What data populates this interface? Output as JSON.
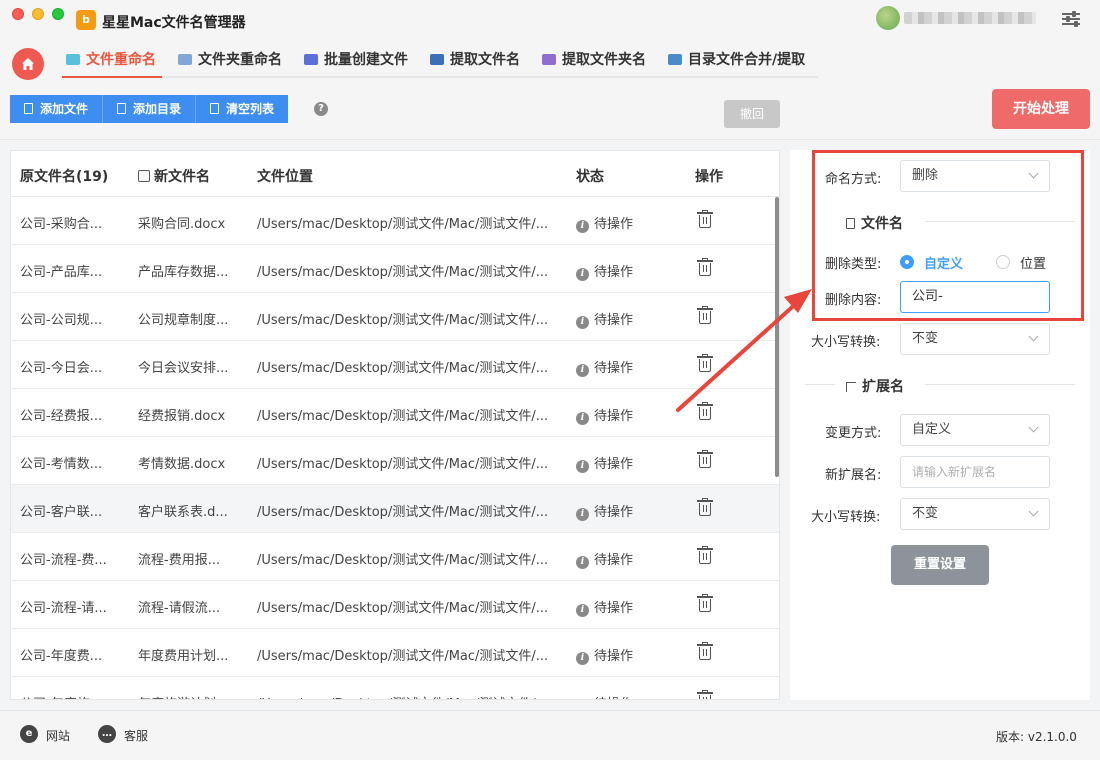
{
  "app": {
    "title": "星星Mac文件名管理器",
    "logo_text": "b"
  },
  "tabs": [
    {
      "label": "文件重命名",
      "active": true,
      "icon": "file-rename-icon"
    },
    {
      "label": "文件夹重命名",
      "active": false,
      "icon": "folder-rename-icon"
    },
    {
      "label": "批量创建文件",
      "active": false,
      "icon": "batch-create-icon"
    },
    {
      "label": "提取文件名",
      "active": false,
      "icon": "extract-filename-icon"
    },
    {
      "label": "提取文件夹名",
      "active": false,
      "icon": "extract-foldername-icon"
    },
    {
      "label": "目录文件合并/提取",
      "active": false,
      "icon": "merge-extract-icon"
    }
  ],
  "toolbar": {
    "add_file": "添加文件",
    "add_dir": "添加目录",
    "clear_list": "清空列表",
    "help": "?",
    "undo": "撤回",
    "start": "开始处理"
  },
  "table": {
    "headers": {
      "original": "原文件名(19)",
      "new": "新文件名",
      "location": "文件位置",
      "status": "状态",
      "action": "操作"
    },
    "rows": [
      {
        "original": "公司-采购合...",
        "new": "采购合同.docx",
        "location": "/Users/mac/Desktop/测试文件/Mac/测试文件/...",
        "status": "待操作"
      },
      {
        "original": "公司-产品库...",
        "new": "产品库存数据...",
        "location": "/Users/mac/Desktop/测试文件/Mac/测试文件/...",
        "status": "待操作"
      },
      {
        "original": "公司-公司规...",
        "new": "公司规章制度...",
        "location": "/Users/mac/Desktop/测试文件/Mac/测试文件/...",
        "status": "待操作"
      },
      {
        "original": "公司-今日会...",
        "new": "今日会议安排...",
        "location": "/Users/mac/Desktop/测试文件/Mac/测试文件/...",
        "status": "待操作"
      },
      {
        "original": "公司-经费报...",
        "new": "经费报销.docx",
        "location": "/Users/mac/Desktop/测试文件/Mac/测试文件/...",
        "status": "待操作"
      },
      {
        "original": "公司-考情数...",
        "new": "考情数据.docx",
        "location": "/Users/mac/Desktop/测试文件/Mac/测试文件/...",
        "status": "待操作"
      },
      {
        "original": "公司-客户联...",
        "new": "客户联系表.d...",
        "location": "/Users/mac/Desktop/测试文件/Mac/测试文件/...",
        "status": "待操作"
      },
      {
        "original": "公司-流程-费...",
        "new": "流程-费用报...",
        "location": "/Users/mac/Desktop/测试文件/Mac/测试文件/...",
        "status": "待操作"
      },
      {
        "original": "公司-流程-请...",
        "new": "流程-请假流...",
        "location": "/Users/mac/Desktop/测试文件/Mac/测试文件/...",
        "status": "待操作"
      },
      {
        "original": "公司-年度费...",
        "new": "年度费用计划...",
        "location": "/Users/mac/Desktop/测试文件/Mac/测试文件/...",
        "status": "待操作"
      },
      {
        "original": "公司-年度旅...",
        "new": "年度旅游计划...",
        "location": "/Users/mac/Desktop/测试文件/Mac/测试文件/...",
        "status": "待操作"
      }
    ]
  },
  "settings": {
    "naming_method_label": "命名方式:",
    "naming_method_value": "删除",
    "filename_section": "文件名",
    "delete_type_label": "删除类型:",
    "delete_type_custom": "自定义",
    "delete_type_position": "位置",
    "delete_content_label": "删除内容:",
    "delete_content_value": "公司-",
    "case_label": "大小写转换:",
    "case_value": "不变",
    "ext_section": "扩展名",
    "change_method_label": "变更方式:",
    "change_method_value": "自定义",
    "new_ext_label": "新扩展名:",
    "new_ext_placeholder": "请输入新扩展名",
    "ext_case_label": "大小写转换:",
    "ext_case_value": "不变",
    "reset": "重置设置"
  },
  "footer": {
    "website": "网站",
    "support": "客服",
    "version": "版本: v2.1.0.0"
  },
  "colors": {
    "accent_red": "#ef6b69",
    "primary_blue": "#3d8ef0",
    "annotation_red": "#e8453c"
  }
}
